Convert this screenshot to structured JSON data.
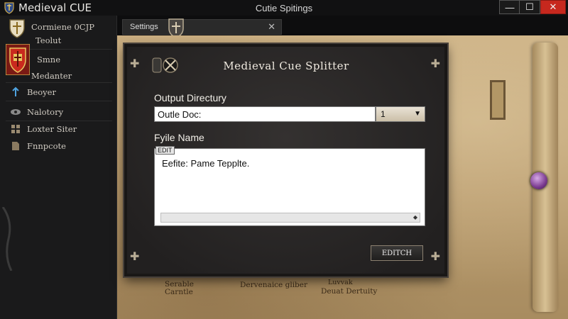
{
  "window": {
    "app_title": "Medieval CUE",
    "title": "Cutie Spitings",
    "min_glyph": "—",
    "max_glyph": "☐",
    "close_glyph": "✕"
  },
  "sidebar": {
    "items": [
      {
        "label": "Cormiene 0CJP",
        "icon": "shield-icon"
      },
      {
        "label": "Teolut",
        "icon": ""
      },
      {
        "label": "Smne",
        "icon": "shield-icon"
      },
      {
        "label": "Medanter",
        "icon": ""
      },
      {
        "label": "Beoyer",
        "icon": "pin-icon"
      },
      {
        "label": "Nalotory",
        "icon": "eye-icon"
      },
      {
        "label": "Loxter Siter",
        "icon": "grid-icon"
      },
      {
        "label": "Fnnpcote",
        "icon": "document-icon"
      }
    ]
  },
  "tab": {
    "label": "Settings",
    "close_glyph": "✕"
  },
  "dialog": {
    "title": "Medieval Cue Splitter",
    "output_label": "Output Directury",
    "output_value": "Outle Doc:",
    "combo_value": "1",
    "file_label": "Fyile Name",
    "edit_tag": "EDIT",
    "file_value": "Eefite: Pame Tepplte.",
    "edit_button": "EDITCH"
  },
  "footer": {
    "left": "Serable\nCarntle",
    "center": "Dervenaice gliber",
    "right_top": "Luvvak",
    "right_bottom": "Deuat Dertuity"
  },
  "colors": {
    "close_red": "#c7281e",
    "parchment": "#c9ad80",
    "dialog_bg": "#2a2826",
    "orb": "#7a3a8f"
  }
}
